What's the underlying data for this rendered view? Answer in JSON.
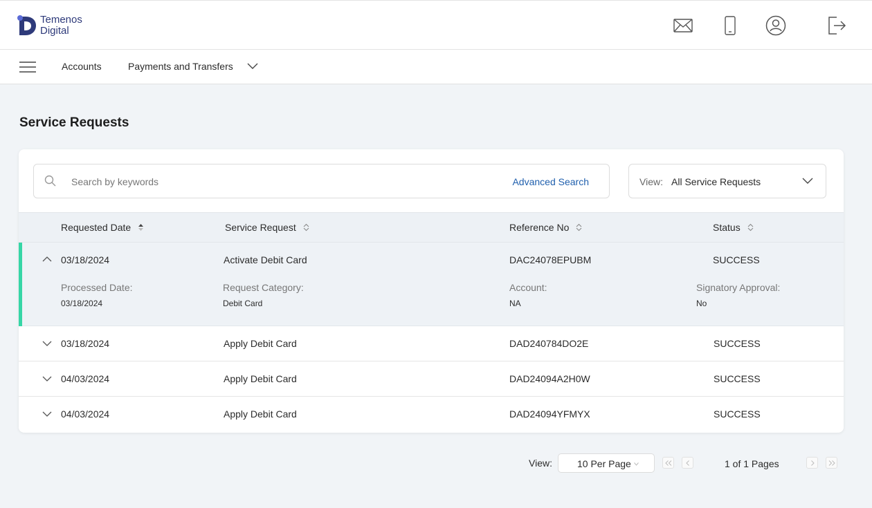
{
  "brand": {
    "line1": "Temenos",
    "line2": "Digital"
  },
  "header_icons": [
    "mail-icon",
    "mobile-icon",
    "user-profile-icon",
    "logout-icon"
  ],
  "nav": {
    "items": [
      {
        "label": "Accounts"
      },
      {
        "label": "Payments and Transfers"
      }
    ]
  },
  "page_title": "Service Requests",
  "search": {
    "placeholder": "Search by keywords",
    "advanced_label": "Advanced Search"
  },
  "view_filter": {
    "label": "View:",
    "value": "All Service Requests"
  },
  "table": {
    "columns": [
      "Requested Date",
      "Service Request",
      "Reference No",
      "Status"
    ],
    "rows": [
      {
        "date": "03/18/2024",
        "request": "Activate Debit Card",
        "ref": "DAC24078EPUBM",
        "status": "SUCCESS",
        "expanded": true,
        "details": {
          "processed_label": "Processed Date:",
          "processed_value": "03/18/2024",
          "category_label": "Request Category:",
          "category_value": "Debit Card",
          "account_label": "Account:",
          "account_value": "NA",
          "approval_label": "Signatory Approval:",
          "approval_value": "No"
        }
      },
      {
        "date": "03/18/2024",
        "request": "Apply Debit Card",
        "ref": "DAD240784DO2E",
        "status": "SUCCESS",
        "expanded": false
      },
      {
        "date": "04/03/2024",
        "request": "Apply Debit Card",
        "ref": "DAD24094A2H0W",
        "status": "SUCCESS",
        "expanded": false
      },
      {
        "date": "04/03/2024",
        "request": "Apply Debit Card",
        "ref": "DAD24094YFMYX",
        "status": "SUCCESS",
        "expanded": false
      }
    ]
  },
  "pagination": {
    "view_label": "View:",
    "per_page": "10 Per Page",
    "info": "1 of 1 Pages"
  },
  "colors": {
    "accent_green": "#36d6a6",
    "link_blue": "#1f5fad",
    "brand_navy": "#2e3a7a"
  }
}
